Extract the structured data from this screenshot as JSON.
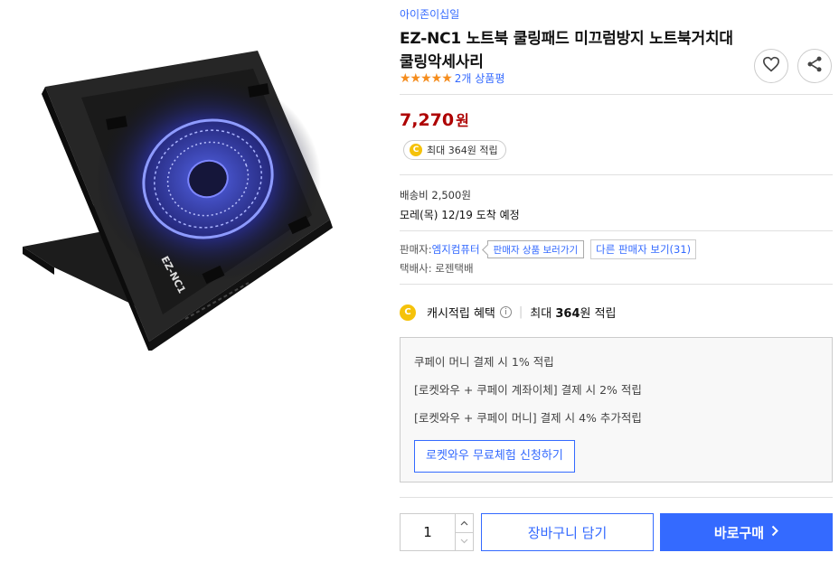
{
  "product": {
    "brand": "아이존이십일",
    "title": "EZ-NC1 노트북 쿨링패드 미끄럼방지 노트북거치대 쿨링악세사리",
    "image_label": "EZ-NC1",
    "review_count_label": "2개 상품평",
    "rating_stars": 5
  },
  "price": {
    "amount": "7,270",
    "unit": "원"
  },
  "cash": {
    "coin_letter": "C",
    "pill_label": "최대 364원 적립"
  },
  "shipping": {
    "fee": "배송비 2,500원",
    "arrival": "모레(목) 12/19 도착 예정"
  },
  "seller": {
    "label": "판매자: ",
    "name": "엠지컴퓨터",
    "products_button": "판매자 상품 보러가기",
    "other_sellers_button": "다른 판매자 보기(31)",
    "courier": "택배사: 로젠택배"
  },
  "benefit": {
    "label": "캐시적립 혜택",
    "info_icon": "i",
    "separator": "|",
    "max_prefix": "최대 ",
    "max_amount": "364",
    "max_suffix": "원 적립",
    "lines": [
      "쿠페이 머니 결제 시 1% 적립",
      "[로켓와우 + 쿠페이 계좌이체] 결제 시 2% 적립",
      "[로켓와우 + 쿠페이 머니] 결제 시 4% 추가적립"
    ],
    "trial_button": "로켓와우 무료체험 신청하기"
  },
  "purchase": {
    "quantity": "1",
    "cart_button": "장바구니 담기",
    "buy_button": "바로구매",
    "buy_chevron": "〉"
  },
  "icons": {
    "wishlist": "heart-icon",
    "share": "share-icon",
    "coin": "cash-coin-icon"
  },
  "colors": {
    "accent": "#346aff",
    "price": "#ae0000",
    "star": "#f58d1e",
    "coin": "#f5c20a"
  }
}
